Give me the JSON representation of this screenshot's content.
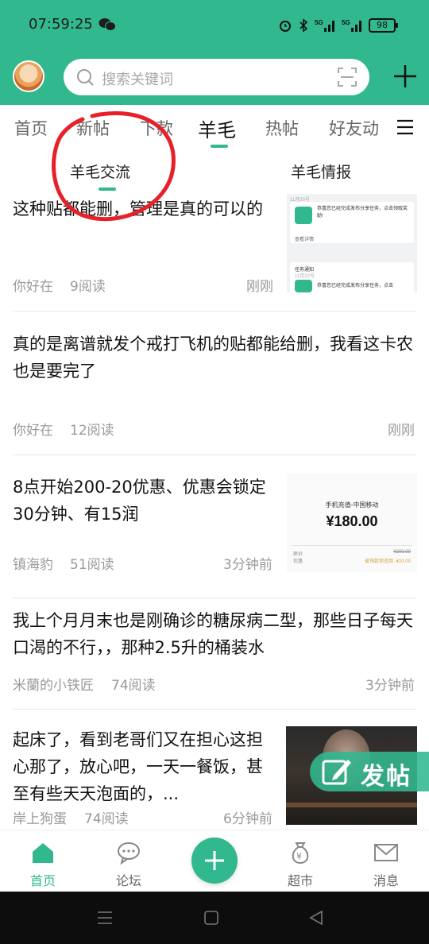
{
  "status_bar": {
    "time": "07:59:25",
    "battery": "98",
    "network": "5G"
  },
  "header": {
    "search_placeholder": "搜索关键词"
  },
  "tabs": [
    {
      "label": "首页"
    },
    {
      "label": "新帖"
    },
    {
      "label": "下款"
    },
    {
      "label": "羊毛"
    },
    {
      "label": "热帖"
    },
    {
      "label": "好友动"
    }
  ],
  "subtabs": [
    {
      "label": "羊毛交流"
    },
    {
      "label": "羊毛情报"
    }
  ],
  "posts": [
    {
      "title": "这种贴都能删，管理是真的可以的",
      "author": "你好在",
      "reads": "9阅读",
      "time": "刚刚",
      "thumb": {
        "card1_text": "恭喜您已经完成发布分享任务，点击领取奖励!",
        "card1_date": "11月20号",
        "card1_link": "查看详情",
        "card2_title": "任务通知",
        "card2_date": "11月22号",
        "card2_text": "恭喜您已经完成发布分享任务，点击"
      }
    },
    {
      "title": "真的是离谱就发个戒打飞机的贴都能给删，我看这卡农也是要完了",
      "author": "你好在",
      "reads": "12阅读",
      "time": "刚刚"
    },
    {
      "title": "8点开始200-20优惠、优惠会锁定30分钟、有15润",
      "author": "镇海豹",
      "reads": "51阅读",
      "time": "3分钟前",
      "thumb": {
        "heading": "手机充值-中国移动",
        "price": "¥180.00",
        "row1_label": "原价",
        "row1_value": "¥200.00",
        "row2_label": "优惠",
        "row2_value": "省钱款项适用 -¥20.00"
      }
    },
    {
      "title": "我上个月月末也是刚确诊的糖尿病二型，那些日子每天口渴的不行，，那种2.5升的桶装水",
      "author": "米蘭的小铁匠",
      "reads": "74阅读",
      "time": "3分钟前"
    },
    {
      "title": "起床了，看到老哥们又在担心这担心那了，放心吧，一天一餐饭，甚至有些天天泡面的，...",
      "author": "岸上狗蛋",
      "reads": "74阅读",
      "time": "6分钟前"
    }
  ],
  "fab": {
    "label": "发帖"
  },
  "bottom_nav": [
    {
      "label": "首页"
    },
    {
      "label": "论坛"
    },
    {
      "label": "超市"
    },
    {
      "label": "消息"
    }
  ],
  "colors": {
    "brand": "#31b88f",
    "annotation_red": "#e8202a"
  }
}
